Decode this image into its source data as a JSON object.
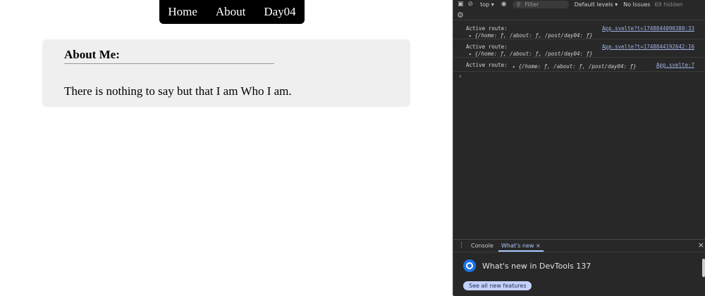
{
  "page": {
    "nav": [
      {
        "label": "Home"
      },
      {
        "label": "About"
      },
      {
        "label": "Day04"
      }
    ],
    "card": {
      "title": "About Me:",
      "text": "There is nothing to say but that I am Who I am."
    }
  },
  "devtools": {
    "toolbar": {
      "context": "top ▾",
      "filter_placeholder": "Filter",
      "levels": "Default levels ▾",
      "issues": "No Issues",
      "hidden": "69 hidden"
    },
    "console": {
      "logs": [
        {
          "message": "Active route:",
          "source": "App.svelte?t=1748844090380:33",
          "object": "{/home: ƒ, /about: ƒ, /post/day04: ƒ}"
        },
        {
          "message": "Active route:",
          "source": "App.svelte?t=1748844192642:16",
          "object": "{/home: ƒ, /about: ƒ, /post/day04: ƒ}"
        },
        {
          "message": "Active route:",
          "source": "App.svelte:7",
          "object": "{/home: ƒ, /about: ƒ, /post/day04: ƒ}"
        }
      ],
      "prompt": "›"
    },
    "drawer": {
      "tabs": [
        "Console",
        "What's new ×"
      ],
      "whats_new_title": "What's new in DevTools 137",
      "button": "See all new features"
    }
  }
}
